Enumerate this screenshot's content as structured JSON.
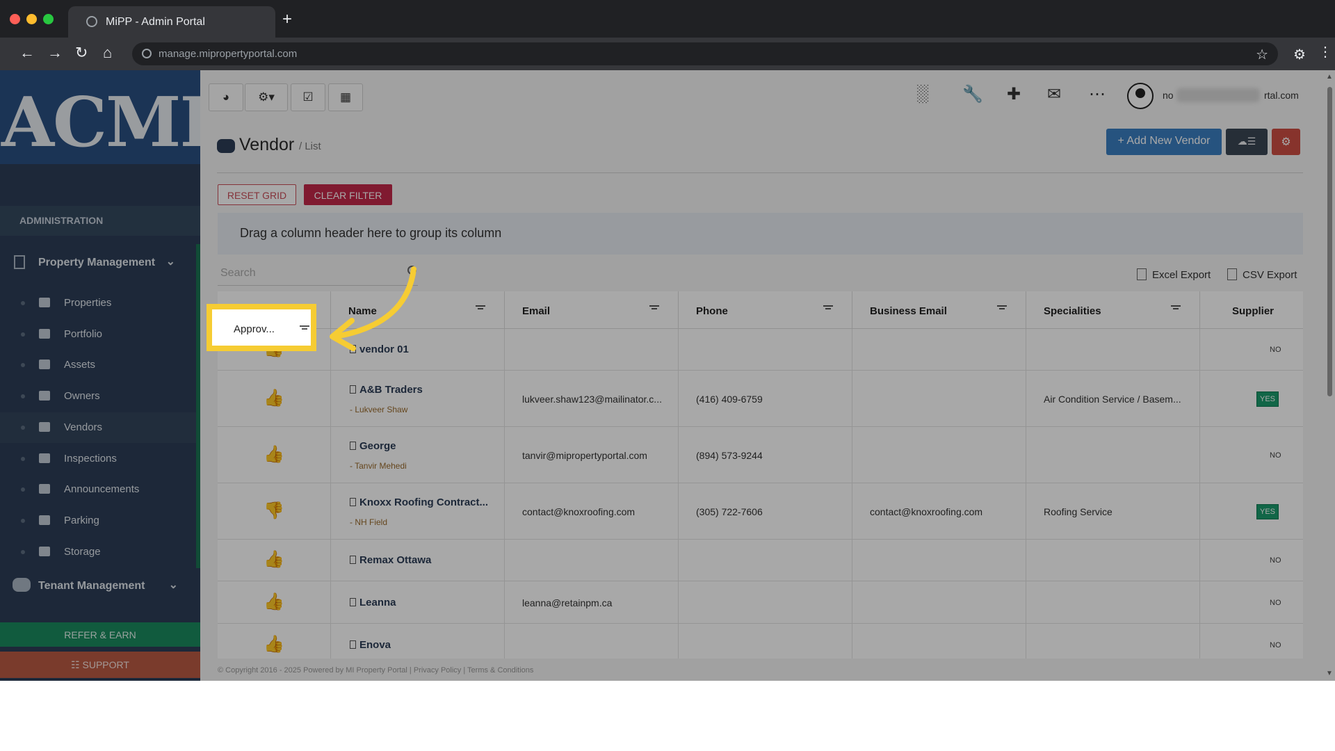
{
  "browser": {
    "tab_title": "MiPP - Admin Portal",
    "url": "manage.mipropertyportal.com"
  },
  "sidebar": {
    "logo_text": "ACME",
    "section_label": "ADMINISTRATION",
    "property_management": {
      "label": "Property Management",
      "items": [
        {
          "label": "Properties",
          "icon": "home-icon"
        },
        {
          "label": "Portfolio",
          "icon": "portfolio-icon"
        },
        {
          "label": "Assets",
          "icon": "assets-icon"
        },
        {
          "label": "Owners",
          "icon": "user-icon"
        },
        {
          "label": "Vendors",
          "icon": "briefcase-icon",
          "active": true
        },
        {
          "label": "Inspections",
          "icon": "search-icon"
        },
        {
          "label": "Announcements",
          "icon": "megaphone-icon"
        },
        {
          "label": "Parking",
          "icon": "car-icon"
        },
        {
          "label": "Storage",
          "icon": "basket-icon"
        }
      ]
    },
    "tenant_management": {
      "label": "Tenant Management"
    },
    "refer_label": "REFER & EARN",
    "support_label": "SUPPORT"
  },
  "header": {
    "user_prefix": "no",
    "user_suffix": "rtal.com"
  },
  "page": {
    "title": "Vendor",
    "breadcrumb": "/ List",
    "add_button": "+ Add New Vendor",
    "reset_grid": "RESET GRID",
    "clear_filter": "CLEAR FILTER",
    "group_hint": "Drag a column header here to group its column",
    "search_placeholder": "Search",
    "excel_export": "Excel Export",
    "csv_export": "CSV Export"
  },
  "grid": {
    "columns": [
      "Approv...",
      "Name",
      "Email",
      "Phone",
      "Business Email",
      "Specialities",
      "Supplier"
    ],
    "rows": [
      {
        "approved": true,
        "name": "vendor 01",
        "contact": "",
        "email": "",
        "phone": "",
        "business_email": "",
        "specialities": "",
        "supplier": "NO"
      },
      {
        "approved": true,
        "name": "A&B Traders",
        "contact": "- Lukveer Shaw",
        "email": "lukveer.shaw123@mailinator.c...",
        "phone": "(416) 409-6759",
        "business_email": "",
        "specialities": "Air Condition Service / Basem...",
        "supplier": "YES"
      },
      {
        "approved": true,
        "name": "George",
        "contact": "- Tanvir Mehedi",
        "email": "tanvir@mipropertyportal.com",
        "phone": "(894) 573-9244",
        "business_email": "",
        "specialities": "",
        "supplier": "NO"
      },
      {
        "approved": false,
        "name": "Knoxx Roofing Contract...",
        "contact": "- NH Field",
        "email": "contact@knoxroofing.com",
        "phone": "(305) 722-7606",
        "business_email": "contact@knoxroofing.com",
        "specialities": "Roofing Service",
        "supplier": "YES"
      },
      {
        "approved": true,
        "name": "Remax Ottawa",
        "contact": "",
        "email": "",
        "phone": "",
        "business_email": "",
        "specialities": "",
        "supplier": "NO"
      },
      {
        "approved": true,
        "name": "Leanna",
        "contact": "",
        "email": "leanna@retainpm.ca",
        "phone": "",
        "business_email": "",
        "specialities": "",
        "supplier": "NO"
      },
      {
        "approved": true,
        "name": "Enova",
        "contact": "",
        "email": "",
        "phone": "",
        "business_email": "",
        "specialities": "",
        "supplier": "NO"
      }
    ]
  },
  "footer": {
    "copyright": "© Copyright 2016 - 2025 Powered by MI Property Portal | Privacy Policy | Terms & Conditions"
  },
  "colors": {
    "highlight": "#f6cc33",
    "approve": "#3a9a44",
    "reject": "#c63a3a",
    "yes_badge": "#1a9b6c"
  }
}
